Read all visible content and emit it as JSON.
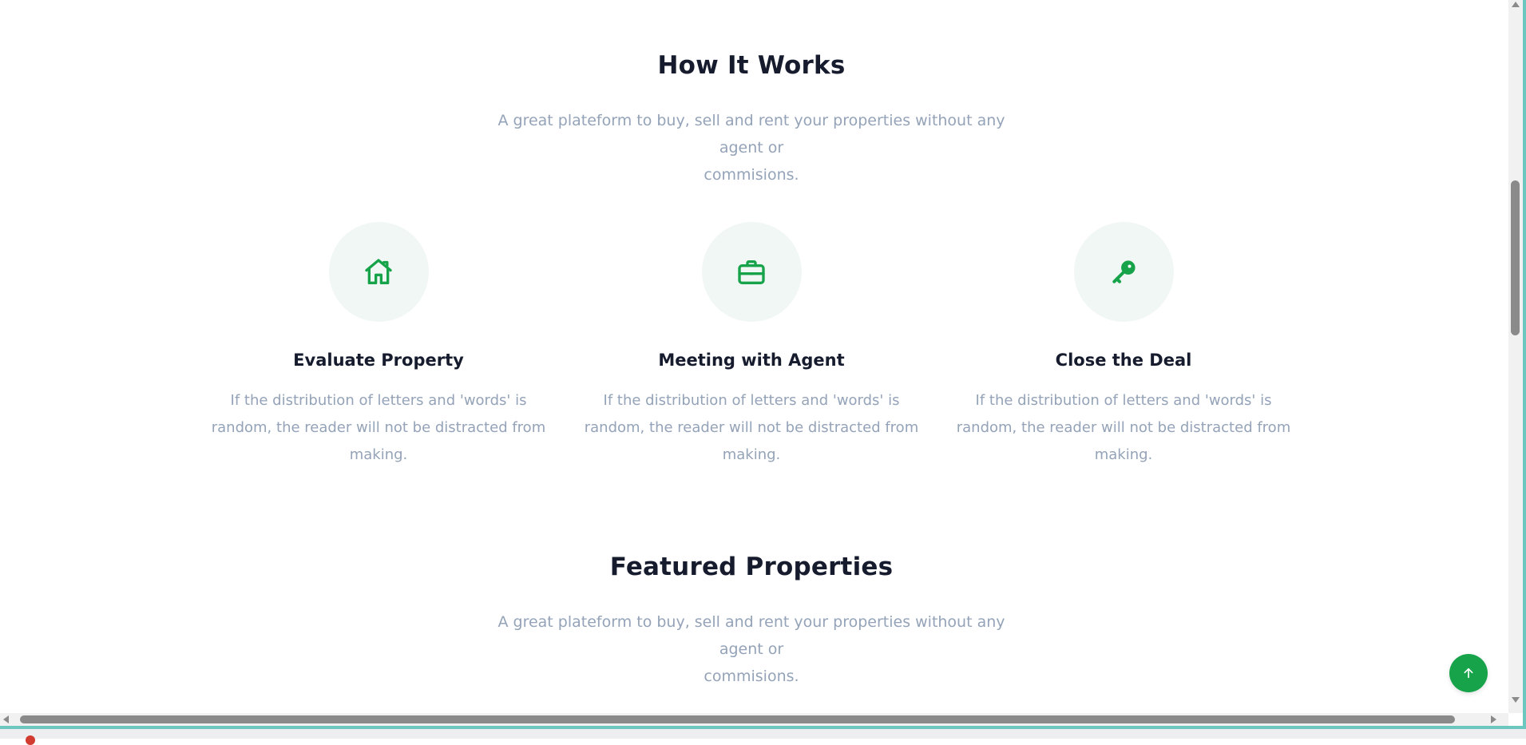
{
  "how_it_works": {
    "title": "How It Works",
    "subtitle_line1": "A great plateform to buy, sell and rent your properties without any agent or",
    "subtitle_line2": "commisions."
  },
  "features": [
    {
      "icon": "home-icon",
      "title": "Evaluate Property",
      "text_line1": "If the distribution of letters and 'words' is",
      "text_line2": "random, the reader will not be distracted from",
      "text_line3": "making."
    },
    {
      "icon": "briefcase-icon",
      "title": "Meeting with Agent",
      "text_line1": "If the distribution of letters and 'words' is",
      "text_line2": "random, the reader will not be distracted from",
      "text_line3": "making."
    },
    {
      "icon": "key-icon",
      "title": "Close the Deal",
      "text_line1": "If the distribution of letters and 'words' is",
      "text_line2": "random, the reader will not be distracted from",
      "text_line3": "making."
    }
  ],
  "featured_properties": {
    "title": "Featured Properties",
    "subtitle_line1": "A great plateform to buy, sell and rent your properties without any agent or",
    "subtitle_line2": "commisions."
  },
  "back_to_top": {
    "icon": "arrow-up-icon"
  },
  "colors": {
    "accent": "#16a34a",
    "heading": "#161c2d",
    "muted": "#94a3b8",
    "icon_bg": "#f1f7f4"
  }
}
